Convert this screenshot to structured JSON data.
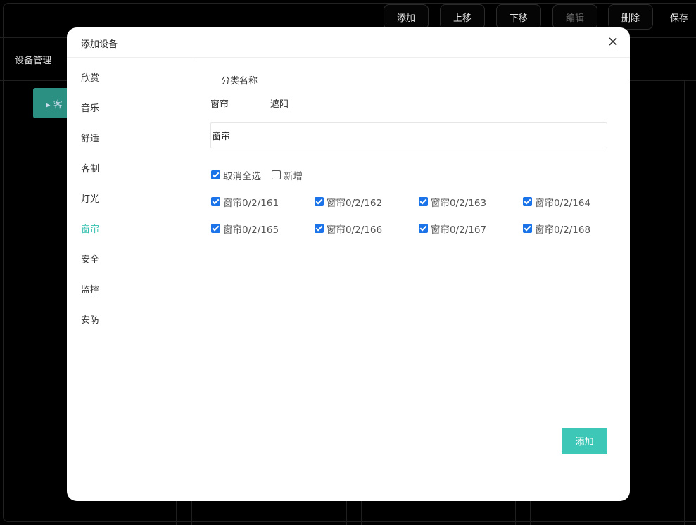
{
  "background": {
    "toolbar": [
      {
        "label": "添加",
        "disabled": false
      },
      {
        "label": "上移",
        "disabled": false
      },
      {
        "label": "下移",
        "disabled": false
      },
      {
        "label": "编辑",
        "disabled": true
      },
      {
        "label": "删除",
        "disabled": false
      },
      {
        "label": "保存",
        "disabled": false
      }
    ],
    "page_title": "设备管理",
    "green_tab_label": "▸ 客"
  },
  "modal": {
    "title": "添加设备",
    "sidebar": [
      "欣赏",
      "音乐",
      "舒适",
      "客制",
      "灯光",
      "窗帘",
      "安全",
      "监控",
      "安防"
    ],
    "active_item": "窗帘",
    "category_label": "分类名称",
    "category_options": [
      "窗帘",
      "遮阳"
    ],
    "name_input_value": "窗帘",
    "select_all_label": "取消全选",
    "select_all_checked": true,
    "new_label": "新增",
    "new_checked": false,
    "devices": [
      {
        "label": "窗帘0/2/161",
        "checked": true
      },
      {
        "label": "窗帘0/2/162",
        "checked": true
      },
      {
        "label": "窗帘0/2/163",
        "checked": true
      },
      {
        "label": "窗帘0/2/164",
        "checked": true
      },
      {
        "label": "窗帘0/2/165",
        "checked": true
      },
      {
        "label": "窗帘0/2/166",
        "checked": true
      },
      {
        "label": "窗帘0/2/167",
        "checked": true
      },
      {
        "label": "窗帘0/2/168",
        "checked": true
      }
    ],
    "add_button": "添加"
  },
  "colors": {
    "accent": "#3dc7b6",
    "active_text": "#36c1b1",
    "checkbox": "#1a73e8"
  }
}
